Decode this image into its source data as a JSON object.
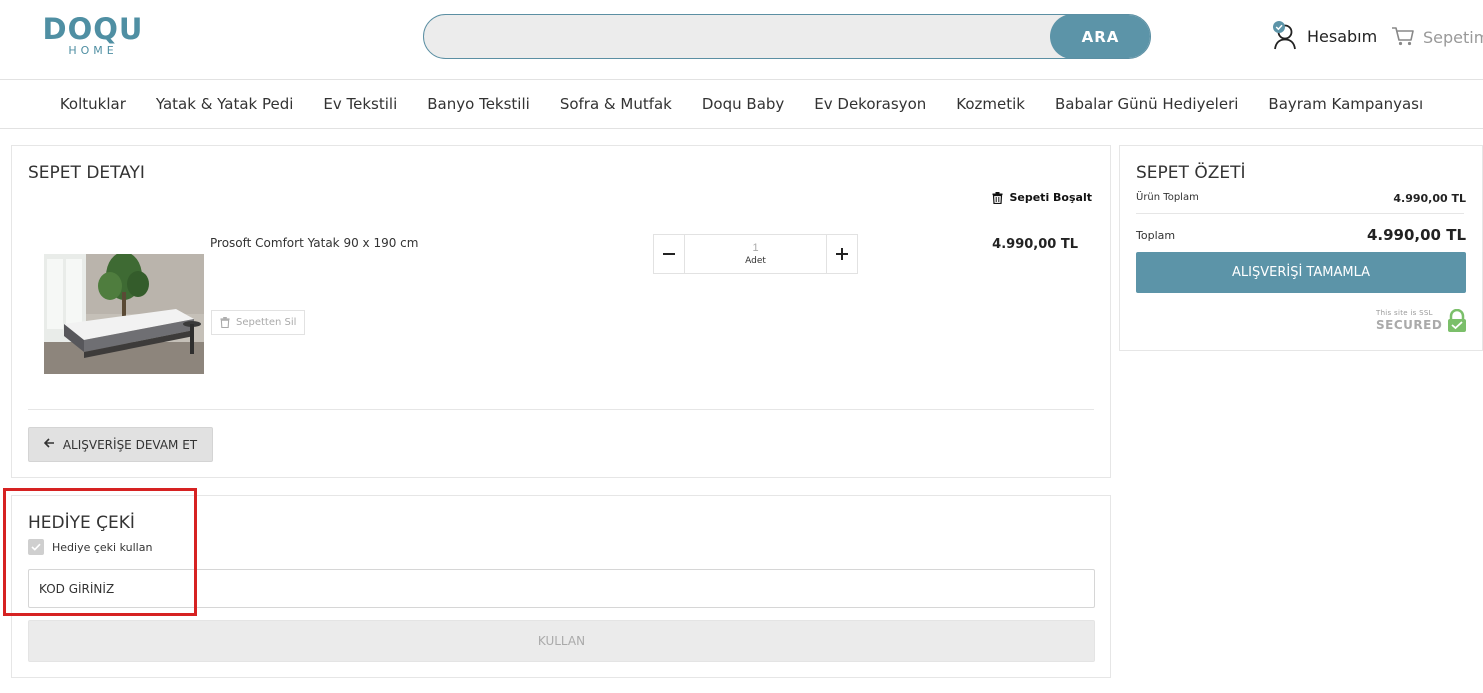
{
  "header": {
    "logo_brand": "DOQU",
    "logo_sub": "HOME",
    "search_placeholder": "",
    "search_button": "ARA",
    "account_label": "Hesabım",
    "cart_label": "Sepetim"
  },
  "nav": {
    "items": [
      "Koltuklar",
      "Yatak & Yatak Pedi",
      "Ev Tekstili",
      "Banyo Tekstili",
      "Sofra & Mutfak",
      "Doqu Baby",
      "Ev Dekorasyon",
      "Kozmetik",
      "Babalar Günü Hediyeleri",
      "Bayram Kampanyası"
    ]
  },
  "cart_detail": {
    "title": "SEPET DETAYI",
    "clear_label": "Sepeti Boşalt",
    "item": {
      "name": "Prosoft Comfort Yatak 90 x 190 cm",
      "remove_label": "Sepetten Sil",
      "quantity": "1",
      "quantity_unit": "Adet",
      "price": "4.990,00 TL"
    },
    "continue_label": "ALIŞVERİŞE DEVAM ET"
  },
  "gift": {
    "title": "HEDİYE ÇEKİ",
    "checkbox_label": "Hediye çeki kullan",
    "input_placeholder": "KOD GİRİNİZ",
    "apply_label": "KULLAN"
  },
  "summary": {
    "title": "SEPET ÖZETİ",
    "subtotal_label": "Ürün Toplam",
    "subtotal_value": "4.990,00 TL",
    "total_label": "Toplam",
    "total_value": "4.990,00 TL",
    "checkout_label": "ALIŞVERİŞİ TAMAMLA",
    "ssl_small": "This site is SSL",
    "ssl_big": "SECURED"
  },
  "colors": {
    "accent": "#5c94a8",
    "highlight": "#d62222"
  }
}
